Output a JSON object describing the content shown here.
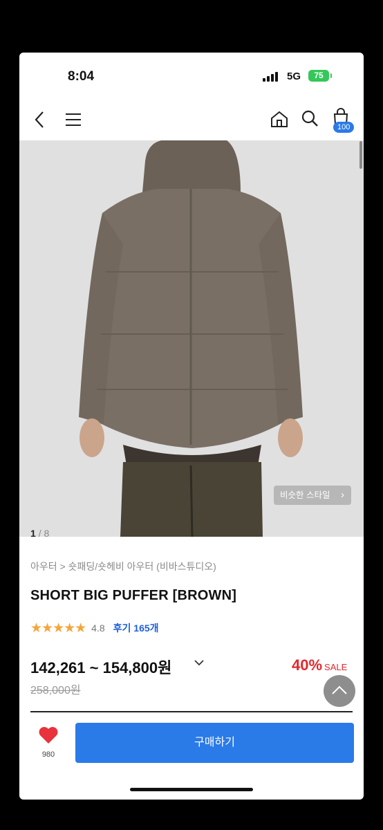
{
  "status_bar": {
    "time": "8:04",
    "network": "5G",
    "battery": "75"
  },
  "nav": {
    "back_icon": "chevron-left-icon",
    "menu_icon": "hamburger-menu-icon",
    "home_icon": "home-icon",
    "search_icon": "search-icon",
    "cart_icon": "shopping-bag-icon",
    "cart_count": "100"
  },
  "product": {
    "similar_style_label": "비슷한 스타일",
    "image_index": "1",
    "image_total": "/ 8",
    "breadcrumb": "아우터 > 숏패딩/숏헤비 아우터 (비바스튜디오)",
    "title": "SHORT BIG PUFFER [BROWN]",
    "stars": "★★★★★",
    "rating": "4.8",
    "reviews_label": "후기 165개",
    "price_range": "142,261 ~ 154,800원",
    "original_price": "258,000원",
    "discount_percent": "40%",
    "sale_label": "SALE"
  },
  "bottom_bar": {
    "like_icon": "heart-icon",
    "like_count": "980",
    "buy_label": "구매하기"
  },
  "colors": {
    "accent_blue": "#2a7ae8",
    "sale_red": "#e0282e",
    "star_orange": "#f4a53b",
    "battery_green": "#34c759",
    "heart_red": "#e8323c"
  }
}
